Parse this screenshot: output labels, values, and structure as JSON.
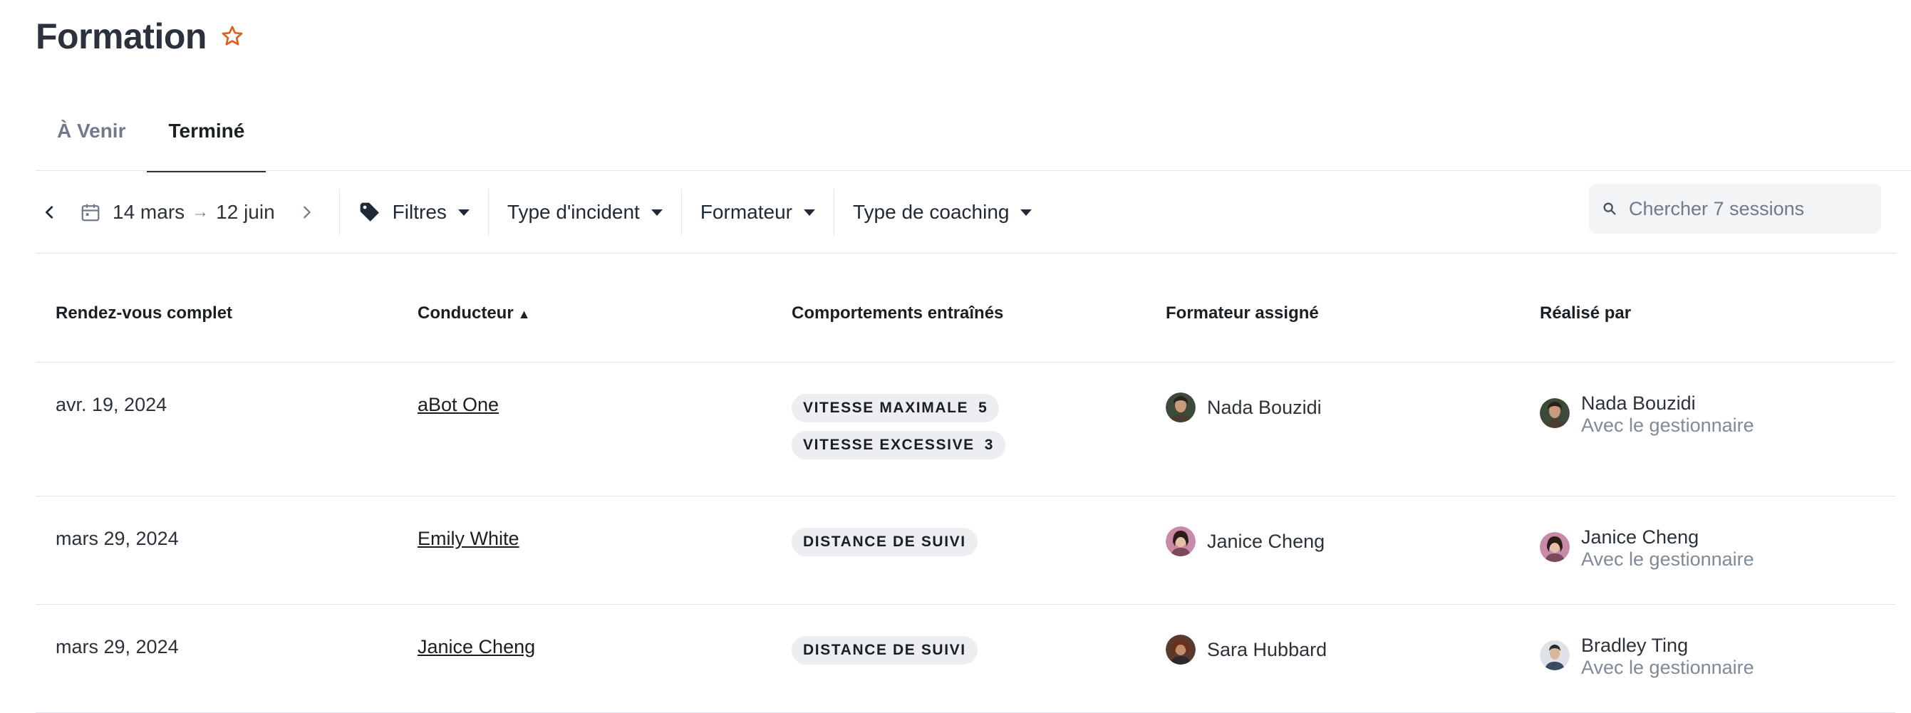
{
  "page": {
    "title": "Formation"
  },
  "tabs": [
    {
      "label": "À Venir"
    },
    {
      "label": "Terminé"
    }
  ],
  "toolbar": {
    "date_start": "14 mars",
    "date_end": "12 juin",
    "filters_label": "Filtres",
    "incident_type_label": "Type d'incident",
    "trainer_label": "Formateur",
    "coaching_type_label": "Type de coaching",
    "search_placeholder": "Chercher 7 sessions"
  },
  "table": {
    "headers": {
      "appointment": "Rendez-vous complet",
      "driver": "Conducteur",
      "behaviors": "Comportements entraînés",
      "assigned_trainer": "Formateur assigné",
      "completed_by": "Réalisé par"
    },
    "rows": [
      {
        "date": "avr. 19, 2024",
        "driver": "aBot One",
        "behaviors": [
          {
            "label": "VITESSE MAXIMALE",
            "count": "5"
          },
          {
            "label": "VITESSE EXCESSIVE",
            "count": "3"
          }
        ],
        "assigned": "Nada Bouzidi",
        "done_by": "Nada Bouzidi",
        "done_sub": "Avec le gestionnaire"
      },
      {
        "date": "mars 29, 2024",
        "driver": "Emily White",
        "behaviors": [
          {
            "label": "DISTANCE DE SUIVI",
            "count": ""
          }
        ],
        "assigned": "Janice Cheng",
        "done_by": "Janice Cheng",
        "done_sub": "Avec le gestionnaire"
      },
      {
        "date": "mars 29, 2024",
        "driver": "Janice Cheng",
        "behaviors": [
          {
            "label": "DISTANCE DE SUIVI",
            "count": ""
          }
        ],
        "assigned": "Sara Hubbard",
        "done_by": "Bradley Ting",
        "done_sub": "Avec le gestionnaire"
      }
    ]
  },
  "colors": {
    "star": "#e35d1c",
    "underline": "#2b323b",
    "muted": "#7f8b99"
  }
}
